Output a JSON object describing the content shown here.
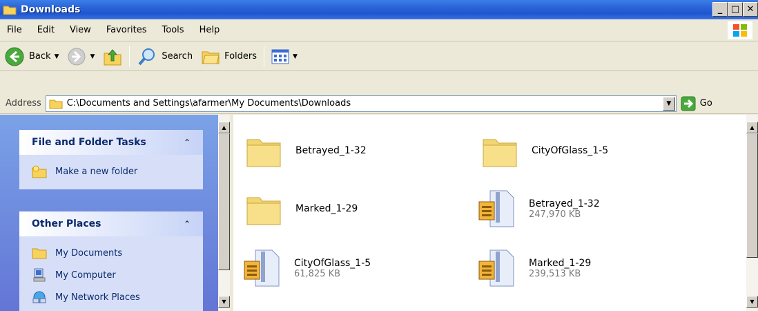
{
  "window": {
    "title": "Downloads"
  },
  "menu": [
    "File",
    "Edit",
    "View",
    "Favorites",
    "Tools",
    "Help"
  ],
  "toolbar": {
    "back": "Back",
    "search": "Search",
    "folders": "Folders"
  },
  "address": {
    "label": "Address",
    "path": "C:\\Documents and Settings\\afarmer\\My Documents\\Downloads",
    "go": "Go"
  },
  "tasks_panel": {
    "title": "File and Folder Tasks",
    "items": [
      "Make a new folder"
    ]
  },
  "places_panel": {
    "title": "Other Places",
    "items": [
      "My Documents",
      "My Computer",
      "My Network Places"
    ]
  },
  "files": [
    {
      "name": "Betrayed_1-32",
      "type": "folder",
      "size": ""
    },
    {
      "name": "CityOfGlass_1-5",
      "type": "folder",
      "size": ""
    },
    {
      "name": "Marked_1-29",
      "type": "folder",
      "size": ""
    },
    {
      "name": "Betrayed_1-32",
      "type": "zip",
      "size": "247,970 KB"
    },
    {
      "name": "CityOfGlass_1-5",
      "type": "zip",
      "size": "61,825 KB"
    },
    {
      "name": "Marked_1-29",
      "type": "zip",
      "size": "239,513 KB"
    }
  ],
  "colors": {
    "title_bar": "#2a63d8",
    "left_pane": "#6f8fe0",
    "panel_text": "#0c2a6e"
  }
}
